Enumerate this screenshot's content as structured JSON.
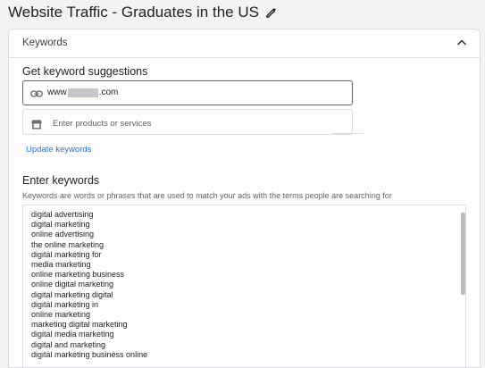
{
  "header": {
    "title": "Website Traffic - Graduates in the US",
    "edit_icon": "pencil-icon"
  },
  "card": {
    "title": "Keywords",
    "collapse_icon": "chevron-up-icon"
  },
  "suggestions": {
    "heading": "Get keyword suggestions",
    "url_prefix": "www",
    "url_suffix": ".com",
    "url_icon": "link-icon",
    "products_placeholder": "Enter products or services",
    "products_icon": "store-icon",
    "update_label": "Update keywords"
  },
  "keywords": {
    "heading": "Enter keywords",
    "help_text": "Keywords are words or phrases that are used to match your ads with the terms people are searching for",
    "items": [
      "digital advertising",
      "digital marketing",
      "online advertising",
      "the online marketing",
      "digital marketing for",
      "media marketing",
      "online marketing business",
      "online digital marketing",
      "digital marketing digital",
      "digital marketing in",
      "online marketing",
      "marketing digital marketing",
      "digital media marketing",
      "digital and marketing",
      "digital marketing business online"
    ]
  },
  "colors": {
    "link": "#1a73e8",
    "page_background": "#f1f3f4",
    "card_background": "#ffffff"
  }
}
